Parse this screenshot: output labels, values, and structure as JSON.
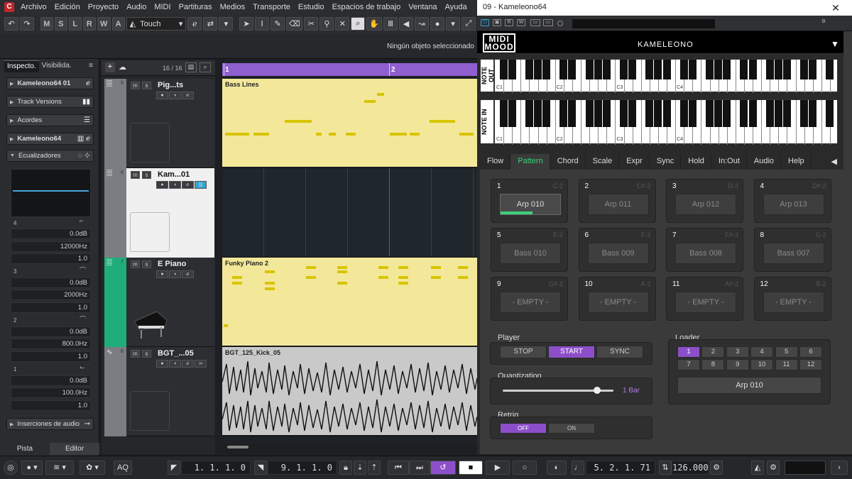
{
  "menu": [
    "Archivo",
    "Edición",
    "Proyecto",
    "Audio",
    "MIDI",
    "Partituras",
    "Medios",
    "Transporte",
    "Estudio",
    "Espacios de trabajo",
    "Ventana",
    "Ayuda"
  ],
  "toolbar": {
    "undo": "↶",
    "redo": "↷",
    "modes": [
      "M",
      "S",
      "L",
      "R",
      "W",
      "A"
    ],
    "automation_mode": "Touch",
    "tool_icons": [
      "arrow-icon",
      "range-icon",
      "pencil-icon",
      "eraser-icon",
      "scissors-icon",
      "glue-icon",
      "mute-icon",
      "zoom-icon",
      "hand-icon",
      "comp-icon",
      "speaker-icon",
      "line-icon"
    ]
  },
  "info_line": "Ningún objeto seleccionado",
  "inspector": {
    "tabs": [
      "Inspecto.",
      "Visibilida."
    ],
    "sections": [
      "Kameleono64 01",
      "Track Versions",
      "Acordes",
      "Kameleono64",
      "Ecualizadores",
      "Inserciones de audio"
    ],
    "eq_bands": [
      {
        "num": "4",
        "gain": "0.0dB",
        "freq": "12000Hz",
        "q": "1.0"
      },
      {
        "num": "3",
        "gain": "0.0dB",
        "freq": "2000Hz",
        "q": "1.0"
      },
      {
        "num": "2",
        "gain": "0.0dB",
        "freq": "800.0Hz",
        "q": "1.0"
      },
      {
        "num": "1",
        "gain": "0.0dB",
        "freq": "100.0Hz",
        "q": "1.0"
      }
    ],
    "footer_tabs": [
      "Pista",
      "Editor"
    ]
  },
  "tracklist": {
    "count": "16 / 16"
  },
  "tracks": [
    {
      "num": "5",
      "name": "Pig...ts",
      "part": "Bass Lines",
      "color": "#7a7d82"
    },
    {
      "num": "6",
      "name": "Kam...01",
      "part": "",
      "color": "#7a7d82"
    },
    {
      "num": "7",
      "name": "E Piano",
      "part": "Funky Piano 2",
      "color": "#1fae7a"
    },
    {
      "num": "8",
      "name": "BGT_...05",
      "part": "BGT_125_Kick_05",
      "color": "#7a7d82"
    }
  ],
  "ruler": {
    "bars": [
      "1",
      "2"
    ]
  },
  "plugin": {
    "window_title": "09 - Kameleono64",
    "logo": "MIDI MOOD",
    "title": "KAMELEONO",
    "keyboard_labels": [
      "NOTE OUT",
      "NOTE IN"
    ],
    "octaves": [
      "C1",
      "C2",
      "C3",
      "C4"
    ],
    "tabs": [
      "Flow",
      "Pattern",
      "Chord",
      "Scale",
      "Expr",
      "Sync",
      "Hold",
      "In:Out",
      "Audio",
      "Help"
    ],
    "active_tab": "Pattern",
    "slots": [
      {
        "n": "1",
        "key": "C-2",
        "name": "Arp 010",
        "active": true,
        "progress": 0.52
      },
      {
        "n": "2",
        "key": "C#-2",
        "name": "Arp 011"
      },
      {
        "n": "3",
        "key": "D-2",
        "name": "Arp 012"
      },
      {
        "n": "4",
        "key": "D#-2",
        "name": "Arp 013"
      },
      {
        "n": "5",
        "key": "E-2",
        "name": "Bass 010"
      },
      {
        "n": "6",
        "key": "F-2",
        "name": "Bass 009"
      },
      {
        "n": "7",
        "key": "F#-2",
        "name": "Bass 008"
      },
      {
        "n": "8",
        "key": "G-2",
        "name": "Bass 007"
      },
      {
        "n": "9",
        "key": "G#-2",
        "name": "- EMPTY -"
      },
      {
        "n": "10",
        "key": "A-2",
        "name": "- EMPTY -"
      },
      {
        "n": "11",
        "key": "A#-2",
        "name": "- EMPTY -"
      },
      {
        "n": "12",
        "key": "B-2",
        "name": "- EMPTY -"
      }
    ],
    "player": {
      "label": "Player",
      "stop": "STOP",
      "start": "START",
      "sync": "SYNC"
    },
    "loader": {
      "label": "Loader",
      "buttons": [
        "1",
        "2",
        "3",
        "4",
        "5",
        "6",
        "7",
        "8",
        "9",
        "10",
        "11",
        "12"
      ],
      "selected": "Arp 010"
    },
    "quantization": {
      "label": "Quantization",
      "value": "1 Bar",
      "level": 0.85
    },
    "retrig": {
      "label": "Retrig",
      "off": "OFF",
      "on": "ON"
    }
  },
  "transport": {
    "left_locator": "1. 1. 1.  0",
    "right_locator": "9. 1. 1.  0",
    "position": "5. 2. 1. 71",
    "tempo": "126.000",
    "aq": "AQ"
  },
  "colors": {
    "accent": "#8d4fc9",
    "green": "#3cd07a",
    "midi_part": "#f3e89a",
    "ruler": "#8f5fd0"
  }
}
